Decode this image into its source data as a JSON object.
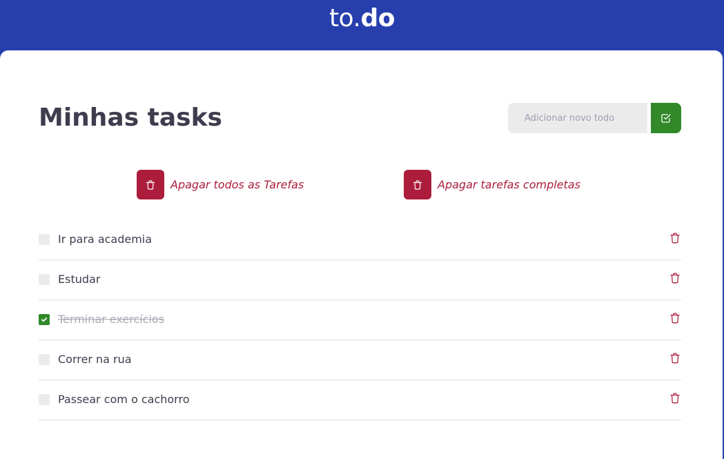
{
  "header": {
    "logo_prefix": "to.",
    "logo_suffix": "do"
  },
  "main": {
    "title": "Minhas tasks",
    "new_todo": {
      "value": "",
      "placeholder": "Adicionar novo todo"
    },
    "add_button_icon": "check-square-icon",
    "bulk_actions": [
      {
        "label": "Apagar todos as Tarefas",
        "icon": "trash-icon"
      },
      {
        "label": "Apagar tarefas completas",
        "icon": "trash-icon"
      }
    ],
    "tasks": [
      {
        "title": "Ir para academia",
        "completed": false
      },
      {
        "title": "Estudar",
        "completed": false
      },
      {
        "title": "Terminar exercícios",
        "completed": true
      },
      {
        "title": "Correr na rua",
        "completed": false
      },
      {
        "title": "Passear com o cachorro",
        "completed": false
      }
    ]
  },
  "colors": {
    "header_bg": "#273fad",
    "accent_green": "#31892a",
    "danger_red": "#ac1d3c",
    "text_dark": "#3d3d4d",
    "input_bg": "#ebebeb"
  }
}
